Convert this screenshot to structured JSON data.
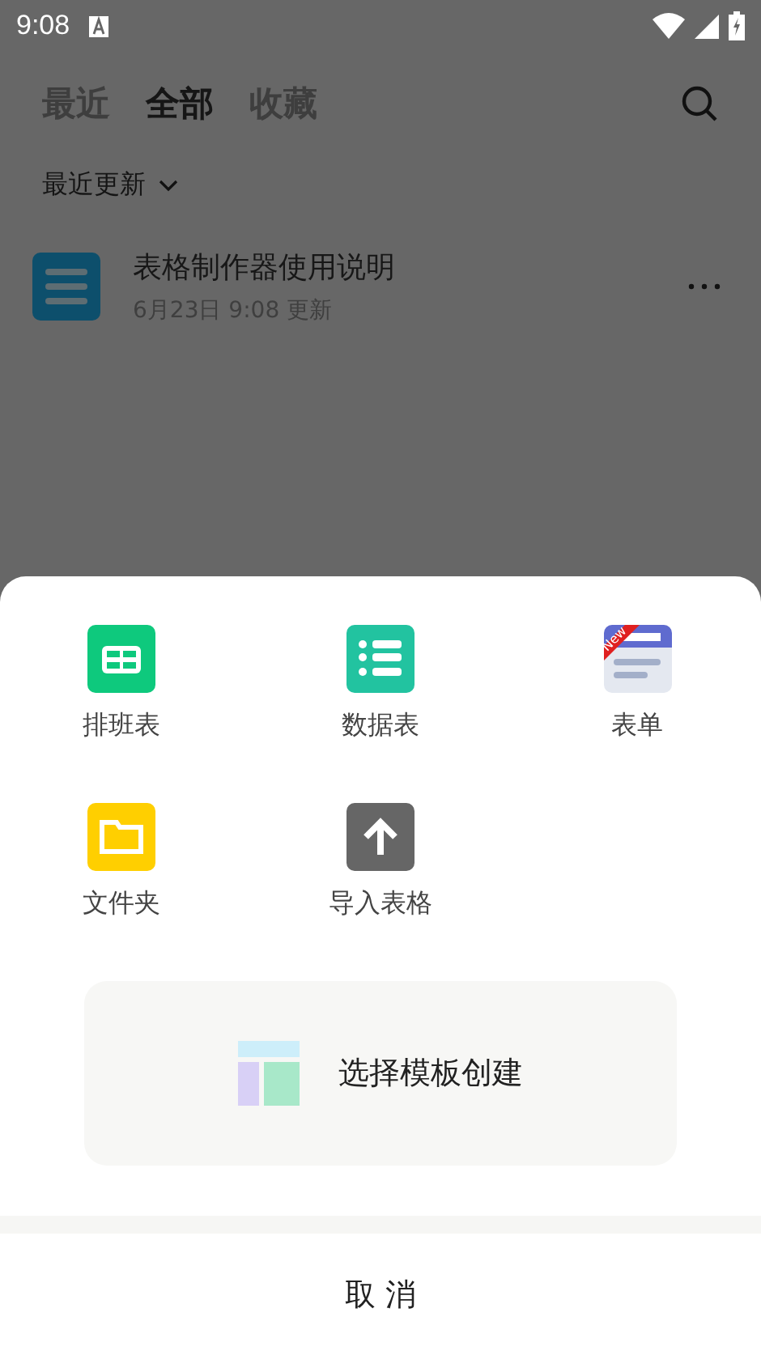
{
  "status_bar": {
    "time": "9:08"
  },
  "tabs": [
    {
      "label": "最近",
      "selected": false
    },
    {
      "label": "全部",
      "selected": true
    },
    {
      "label": "收藏",
      "selected": false
    }
  ],
  "sort": {
    "label": "最近更新"
  },
  "files": [
    {
      "name": "表格制作器使用说明",
      "meta": "6月23日 9:08 更新"
    }
  ],
  "sheet": {
    "items": [
      {
        "kind": "schedule",
        "label": "排班表"
      },
      {
        "kind": "datasheet",
        "label": "数据表"
      },
      {
        "kind": "form",
        "label": "表单",
        "badge": "New"
      },
      {
        "kind": "folder",
        "label": "文件夹"
      },
      {
        "kind": "import",
        "label": "导入表格"
      }
    ],
    "template_button": "选择模板创建",
    "cancel": "取 消"
  }
}
